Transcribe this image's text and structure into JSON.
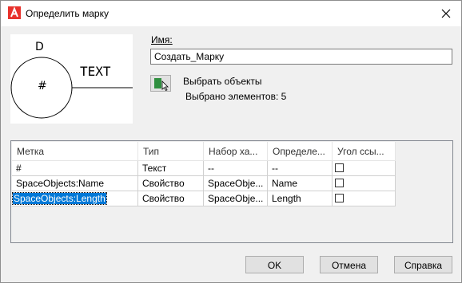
{
  "window": {
    "title": "Определить марку",
    "close_icon": "close-icon",
    "app_icon": "autocad-logo-icon"
  },
  "preview": {
    "top_label": "D",
    "center_label": "#",
    "right_label": "TEXT"
  },
  "form": {
    "name_label": "Имя:",
    "name_value": "Создать_Марку",
    "select_button_icon": "select-objects-icon",
    "select_label": "Выбрать объекты",
    "count_label": "Выбрано элементов: 5"
  },
  "table": {
    "headers": [
      "Метка",
      "Тип",
      "Набор ха...",
      "Определе...",
      "Угол ссы..."
    ],
    "rows": [
      {
        "label": "#",
        "type": "Текст",
        "set": "--",
        "def": "--",
        "checked": false
      },
      {
        "label": "SpaceObjects:Name",
        "type": "Свойство",
        "set": "SpaceObje...",
        "def": "Name",
        "checked": false
      },
      {
        "label": "SpaceObjects:Length",
        "type": "Свойство",
        "set": "SpaceObje...",
        "def": "Length",
        "checked": false,
        "selected": true
      }
    ]
  },
  "buttons": {
    "ok": "OK",
    "cancel": "Отмена",
    "help": "Справка"
  }
}
